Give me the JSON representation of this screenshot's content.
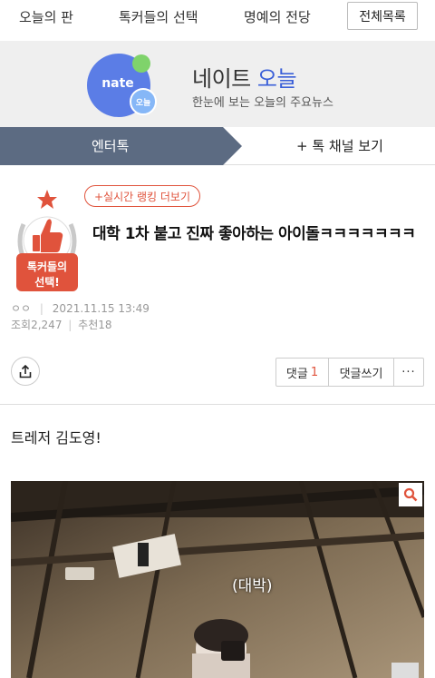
{
  "top_nav": {
    "items": [
      "오늘의 판",
      "톡커들의 선택",
      "명예의 전당"
    ],
    "all_button": "전체목록"
  },
  "banner": {
    "logo_text": "nate",
    "logo_small_text": "오늘",
    "title_main": "네이트",
    "title_accent": "오늘",
    "subtitle": "한눈에 보는 오늘의 주요뉴스"
  },
  "tabs": {
    "active": "엔터톡",
    "other": "+ 톡 채널 보기"
  },
  "article": {
    "badge_text_line1": "톡커들의",
    "badge_text_line2": "선택!",
    "ranking_pill": "+실시간 랭킹 더보기",
    "title": "대학 1차 붙고 진짜 좋아하는 아이돌ㅋㅋㅋㅋㅋㅋㅋ",
    "author": "ㅇㅇ",
    "date": "2021.11.15 13:49",
    "views_label": "조회",
    "views": "2,247",
    "recommend_label": "추천",
    "recommend": "18",
    "body": "트레저 김도영!",
    "image_caption": "(대박)"
  },
  "actions": {
    "comment_label": "댓글",
    "comment_count": "1",
    "write_label": "댓글쓰기",
    "more_label": "···"
  },
  "colors": {
    "accent_red": "#e0533c",
    "tab_active_bg": "#5c6b82",
    "nate_blue": "#5b7de6",
    "brand_accent": "#3a5fd8"
  }
}
